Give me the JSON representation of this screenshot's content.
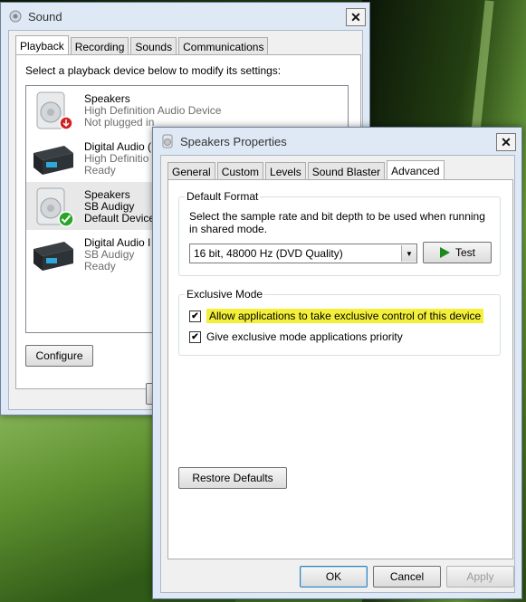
{
  "sound_window": {
    "title": "Sound",
    "tabs": [
      "Playback",
      "Recording",
      "Sounds",
      "Communications"
    ],
    "instruction": "Select a playback device below to modify its settings:",
    "devices": [
      {
        "name": "Speakers",
        "line2": "High Definition Audio Device",
        "line3": "Not plugged in",
        "icon": "speaker-icon",
        "badge": "unplugged-icon"
      },
      {
        "name": "Digital Audio (",
        "line2": "High Definitio",
        "line3": "Ready",
        "icon": "digital-device-icon"
      },
      {
        "name": "Speakers",
        "line2": "SB Audigy",
        "line3": "Default Device",
        "icon": "speaker-icon",
        "badge": "default-check-icon"
      },
      {
        "name": "Digital Audio I",
        "line2": "SB Audigy",
        "line3": "Ready",
        "icon": "digital-device-icon"
      }
    ],
    "configure_label": "Configure"
  },
  "props_window": {
    "title": "Speakers Properties",
    "tabs": [
      "General",
      "Custom",
      "Levels",
      "Sound Blaster",
      "Advanced"
    ],
    "active_tab": "Advanced",
    "default_format": {
      "legend": "Default Format",
      "description": "Select the sample rate and bit depth to be used when running in shared mode.",
      "selected": "16 bit, 48000 Hz (DVD Quality)",
      "test_label": "Test"
    },
    "exclusive_mode": {
      "legend": "Exclusive Mode",
      "option1": "Allow applications to take exclusive control of this device",
      "option1_checked": true,
      "option2": "Give exclusive mode applications priority",
      "option2_checked": true,
      "highlight_color": "#f4f03a"
    },
    "restore_label": "Restore Defaults",
    "ok_label": "OK",
    "cancel_label": "Cancel",
    "apply_label": "Apply"
  }
}
